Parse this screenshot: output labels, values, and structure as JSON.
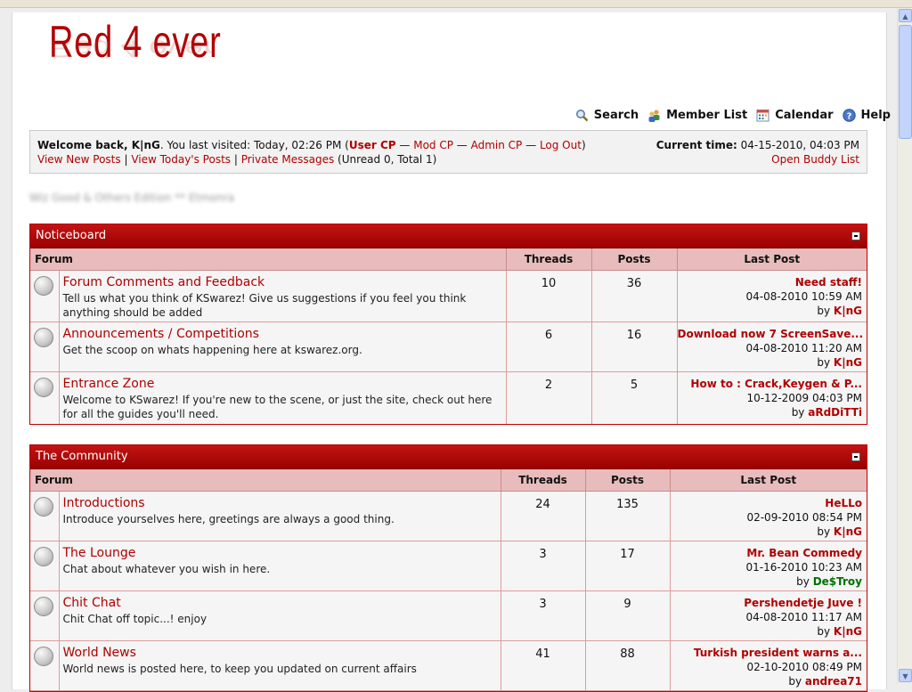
{
  "logo": {
    "text": "Red 4 ever"
  },
  "nav": [
    {
      "label": "Search",
      "icon": "search-icon"
    },
    {
      "label": "Member List",
      "icon": "members-icon"
    },
    {
      "label": "Calendar",
      "icon": "calendar-icon"
    },
    {
      "label": "Help",
      "icon": "help-icon"
    }
  ],
  "welcome": {
    "greeting": "Welcome back, K|nG",
    "last_visit": ". You last visited: Today, 02:26 PM (",
    "user_cp": "User CP",
    "sep": " — ",
    "mod_cp": "Mod CP",
    "admin_cp": "Admin CP",
    "logout": "Log Out",
    "close_paren": ")",
    "view_new": "View New Posts",
    "pipe": " | ",
    "view_today": "View Today's Posts",
    "private_messages": "Private Messages",
    "unread": " (Unread 0, Total 1)",
    "current_time_label": "Current time:",
    "current_time_value": " 04-15-2010, 04:03 PM",
    "buddy_list": "Open Buddy List"
  },
  "blurred_text": "Wiz Good & Others Edition ** Etmonra",
  "columns": {
    "forum": "Forum",
    "threads": "Threads",
    "posts": "Posts",
    "last_post": "Last Post"
  },
  "categories": [
    {
      "title": "Noticeboard",
      "forums": [
        {
          "title": "Forum Comments and Feedback",
          "desc": "Tell us what you think of KSwarez! Give us suggestions if you feel you think anything should be added",
          "threads": "10",
          "posts": "36",
          "lp_title": "Need staff!",
          "lp_date": "04-08-2010 10:59 AM",
          "lp_by": "by ",
          "lp_user": "K|nG",
          "lp_color": "red"
        },
        {
          "title": "Announcements / Competitions",
          "desc": "Get the scoop on whats happening here at kswarez.org.",
          "threads": "6",
          "posts": "16",
          "lp_title": "Download now 7 ScreenSave...",
          "lp_date": "04-08-2010 11:20 AM",
          "lp_by": "by ",
          "lp_user": "K|nG",
          "lp_color": "red"
        },
        {
          "title": "Entrance Zone",
          "desc": "Welcome to KSwarez! If you're new to the scene, or just the site, check out here for all the guides you'll need.",
          "threads": "2",
          "posts": "5",
          "lp_title": "How to : Crack,Keygen & P...",
          "lp_date": "10-12-2009 04:03 PM",
          "lp_by": "by ",
          "lp_user": "aRdDiTTi",
          "lp_color": "red"
        }
      ]
    },
    {
      "title": "The Community",
      "forums": [
        {
          "title": "Introductions",
          "desc": "Introduce yourselves here, greetings are always a good thing.",
          "threads": "24",
          "posts": "135",
          "lp_title": "HeLLo",
          "lp_date": "02-09-2010 08:54 PM",
          "lp_by": "by ",
          "lp_user": "K|nG",
          "lp_color": "red"
        },
        {
          "title": "The Lounge",
          "desc": "Chat about whatever you wish in here.",
          "threads": "3",
          "posts": "17",
          "lp_title": "Mr. Bean Commedy",
          "lp_date": "01-16-2010 10:23 AM",
          "lp_by": "by ",
          "lp_user": "De$Troy",
          "lp_color": "green"
        },
        {
          "title": "Chit Chat",
          "desc": "Chit Chat off topic...! enjoy",
          "threads": "3",
          "posts": "9",
          "lp_title": "Pershendetje Juve !",
          "lp_date": "04-08-2010 11:17 AM",
          "lp_by": "by ",
          "lp_user": "K|nG",
          "lp_color": "red"
        },
        {
          "title": "World News",
          "desc": "World news is posted here, to keep you updated on current affairs",
          "threads": "41",
          "posts": "88",
          "lp_title": "Turkish president warns a...",
          "lp_date": "02-10-2010 08:49 PM",
          "lp_by": "by ",
          "lp_user": "andrea71",
          "lp_color": "red"
        }
      ]
    }
  ]
}
